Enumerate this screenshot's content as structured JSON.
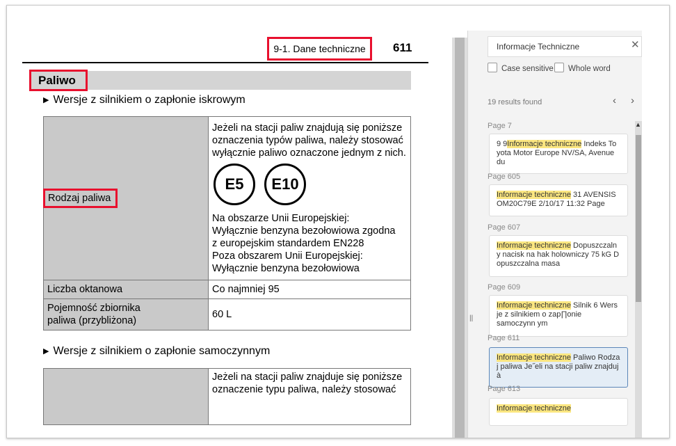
{
  "document": {
    "header_title": "9-1. Dane techniczne",
    "page_number": "611",
    "section_title": "Paliwo",
    "subheading_1": "Wersje z silnikiem o zapłonie iskrowym",
    "subheading_2": "Wersje z silnikiem o zapłonie samoczynnym",
    "row_fuel_type_label": "Rodzaj paliwa",
    "fuel_text_line1": "Jeżeli na stacji paliw znajdują się poniższe",
    "fuel_text_line2": "oznaczenia typów paliwa, należy stosować",
    "fuel_text_line3": "wyłącznie paliwo oznaczone jednym z nich.",
    "badge_e5": "E5",
    "badge_e10": "E10",
    "fuel_text_line4": "Na obszarze Unii Europejskiej:",
    "fuel_text_line5": "Wyłącznie benzyna bezołowiowa zgodna",
    "fuel_text_line6": "z europejskim standardem EN228",
    "fuel_text_line7": "Poza obszarem Unii Europejskiej:",
    "fuel_text_line8": "Wyłącznie benzyna bezołowiowa",
    "row_octane_label": "Liczba oktanowa",
    "row_octane_value": "Co najmniej 95",
    "row_tank_label_line1": "Pojemność zbiornika",
    "row_tank_label_line2": "paliwa (przybliżona)",
    "row_tank_value": "60 L",
    "diesel_text_line1": "Jeżeli na stacji paliw znajduje się poniższe",
    "diesel_text_line2": "oznaczenie typu paliwa, należy stosować"
  },
  "search": {
    "value": "Informacje Techniczne",
    "close_glyph": "✕",
    "case_sensitive_label": "Case sensitive",
    "whole_word_label": "Whole word",
    "results_count": "19 results found",
    "prev_glyph": "‹",
    "next_glyph": "›",
    "splitter_glyph": "||",
    "scroll_up_glyph": "▲",
    "highlight_color": "#fbe680",
    "results": [
      {
        "page": "Page 7",
        "before": "9 9",
        "match": "Informacje techniczne",
        "after": " Indeks To yota Motor Europe NV/SA, Avenue du"
      },
      {
        "page": "Page 605",
        "before": "",
        "match": "Informacje techniczne",
        "after": " 31 AVENSIS OM20C79E 2/10/17 11:32 Page"
      },
      {
        "page": "Page 607",
        "before": "",
        "match": "Informacje techniczne",
        "after": " Dopuszczaln y nacisk na hak holowniczy 75 kG D opuszczalna masa"
      },
      {
        "page": "Page 609",
        "before": "",
        "match": "Informacje techniczne",
        "after": " Silnik 6 Wers je z silnikiem o zap∏onie samoczynn ym"
      },
      {
        "page": "Page 611",
        "before": "",
        "match": "Informacje techniczne",
        "after": " Paliwo Rodza j paliwa Je˝eli na stacji paliw znajduj à"
      },
      {
        "page": "Page 613",
        "before": "",
        "match": "Informacje techniczne",
        "after": ""
      }
    ]
  }
}
